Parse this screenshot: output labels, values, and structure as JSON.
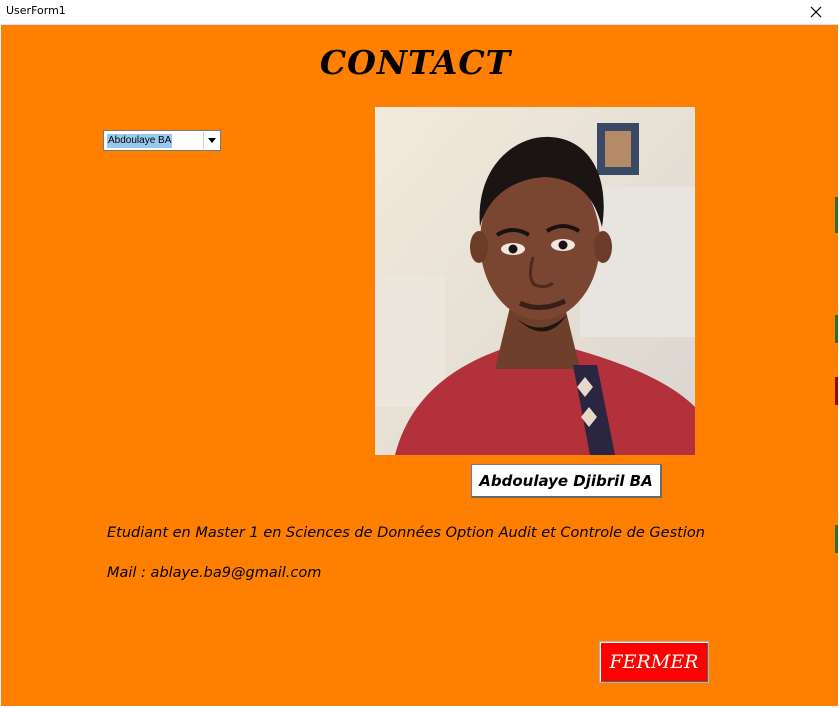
{
  "window": {
    "title": "UserForm1"
  },
  "form": {
    "heading": "CONTACT",
    "combo": {
      "selected": "Abdoulaye BA"
    },
    "name_label": "Abdoulaye Djibril BA",
    "description": "Etudiant en Master 1 en Sciences de Données Option Audit et Controle de Gestion",
    "mail": "Mail : ablaye.ba9@gmail.com",
    "close_button": "FERMER"
  },
  "colors": {
    "background": "#ff7f00",
    "button": "#ff0000"
  },
  "icons": {
    "close": "close-icon",
    "dropdown": "chevron-down-icon"
  }
}
